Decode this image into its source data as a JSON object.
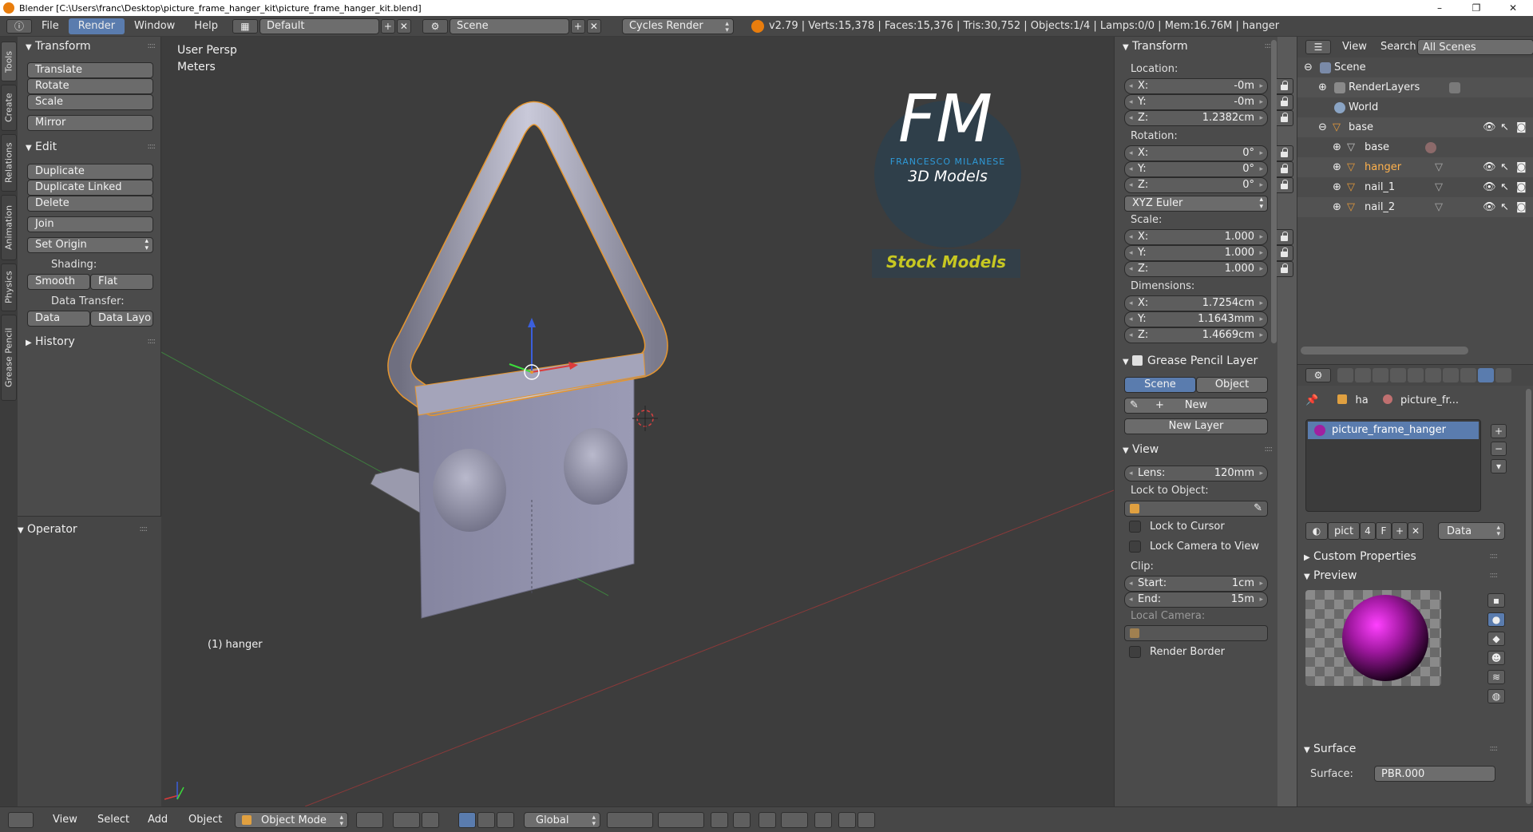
{
  "titlebar": {
    "title": "Blender [C:\\Users\\franc\\Desktop\\picture_frame_hanger_kit\\picture_frame_hanger_kit.blend]",
    "minimize": "–",
    "maximize": "❐",
    "close": "✕"
  },
  "info_header": {
    "menus": [
      "File",
      "Render",
      "Window",
      "Help"
    ],
    "active_menu": "Render",
    "layout": "Default",
    "scene": "Scene",
    "engine": "Cycles Render",
    "stats": "v2.79 | Verts:15,378 | Faces:15,376 | Tris:30,752 | Objects:1/4 | Lamps:0/0 | Mem:16.76M | hanger"
  },
  "tool_tabs": [
    "Tools",
    "Create",
    "Relations",
    "Animation",
    "Physics",
    "Grease Pencil"
  ],
  "toolshelf": {
    "transform_title": "Transform",
    "translate": "Translate",
    "rotate": "Rotate",
    "scale": "Scale",
    "mirror": "Mirror",
    "edit_title": "Edit",
    "duplicate": "Duplicate",
    "duplicate_linked": "Duplicate Linked",
    "delete": "Delete",
    "join": "Join",
    "set_origin": "Set Origin",
    "shading_label": "Shading:",
    "smooth": "Smooth",
    "flat": "Flat",
    "data_transfer_label": "Data Transfer:",
    "data": "Data",
    "data_layout": "Data Layo",
    "history_title": "History",
    "operator_title": "Operator"
  },
  "viewport": {
    "view_name": "User Persp",
    "units": "Meters",
    "object_label": "(1) hanger",
    "logo_letters": "FM",
    "logo_name": "FRANCESCO MILANESE",
    "logo_sub": "3D Models",
    "stock": "Stock Models",
    "accent_color": "#e6962e",
    "logo_blue": "#2e9ad8"
  },
  "npanel": {
    "transform_title": "Transform",
    "location_label": "Location:",
    "location": [
      {
        "k": "X:",
        "v": "-0m"
      },
      {
        "k": "Y:",
        "v": "-0m"
      },
      {
        "k": "Z:",
        "v": "1.2382cm"
      }
    ],
    "rotation_label": "Rotation:",
    "rotation": [
      {
        "k": "X:",
        "v": "0°"
      },
      {
        "k": "Y:",
        "v": "0°"
      },
      {
        "k": "Z:",
        "v": "0°"
      }
    ],
    "rotation_mode": "XYZ Euler",
    "scale_label": "Scale:",
    "scale": [
      {
        "k": "X:",
        "v": "1.000"
      },
      {
        "k": "Y:",
        "v": "1.000"
      },
      {
        "k": "Z:",
        "v": "1.000"
      }
    ],
    "dimensions_label": "Dimensions:",
    "dimensions": [
      {
        "k": "X:",
        "v": "1.7254cm"
      },
      {
        "k": "Y:",
        "v": "1.1643mm"
      },
      {
        "k": "Z:",
        "v": "1.4669cm"
      }
    ],
    "grease_title": "Grease Pencil Layer",
    "scene_btn": "Scene",
    "object_btn": "Object",
    "new_btn": "New",
    "new_layer_btn": "New Layer",
    "view_title": "View",
    "lens_k": "Lens:",
    "lens_v": "120mm",
    "lock_object_label": "Lock to Object:",
    "lock_cursor": "Lock to Cursor",
    "lock_camera": "Lock Camera to View",
    "clip_label": "Clip:",
    "clip_start_k": "Start:",
    "clip_start_v": "1cm",
    "clip_end_k": "End:",
    "clip_end_v": "15m",
    "local_camera_label": "Local Camera:",
    "render_border": "Render Border"
  },
  "outliner": {
    "view": "View",
    "search": "Search",
    "all_scenes": "All Scenes",
    "rows": [
      "Scene",
      "RenderLayers",
      "World",
      "base",
      "base",
      "hanger",
      "nail_1",
      "nail_2"
    ]
  },
  "properties": {
    "crumb_object": "ha",
    "crumb_material": "picture_fr...",
    "material_slot": "picture_frame_hanger",
    "mat_name": "pict",
    "mat_users": "4",
    "mat_fake": "F",
    "link_mode": "Data",
    "custom_properties": "Custom Properties",
    "preview_title": "Preview",
    "surface_title": "Surface",
    "surface_label": "Surface:",
    "surface_value": "PBR.000"
  },
  "bottom_header": {
    "view": "View",
    "select": "Select",
    "add": "Add",
    "object": "Object",
    "mode": "Object Mode",
    "orientation": "Global"
  }
}
